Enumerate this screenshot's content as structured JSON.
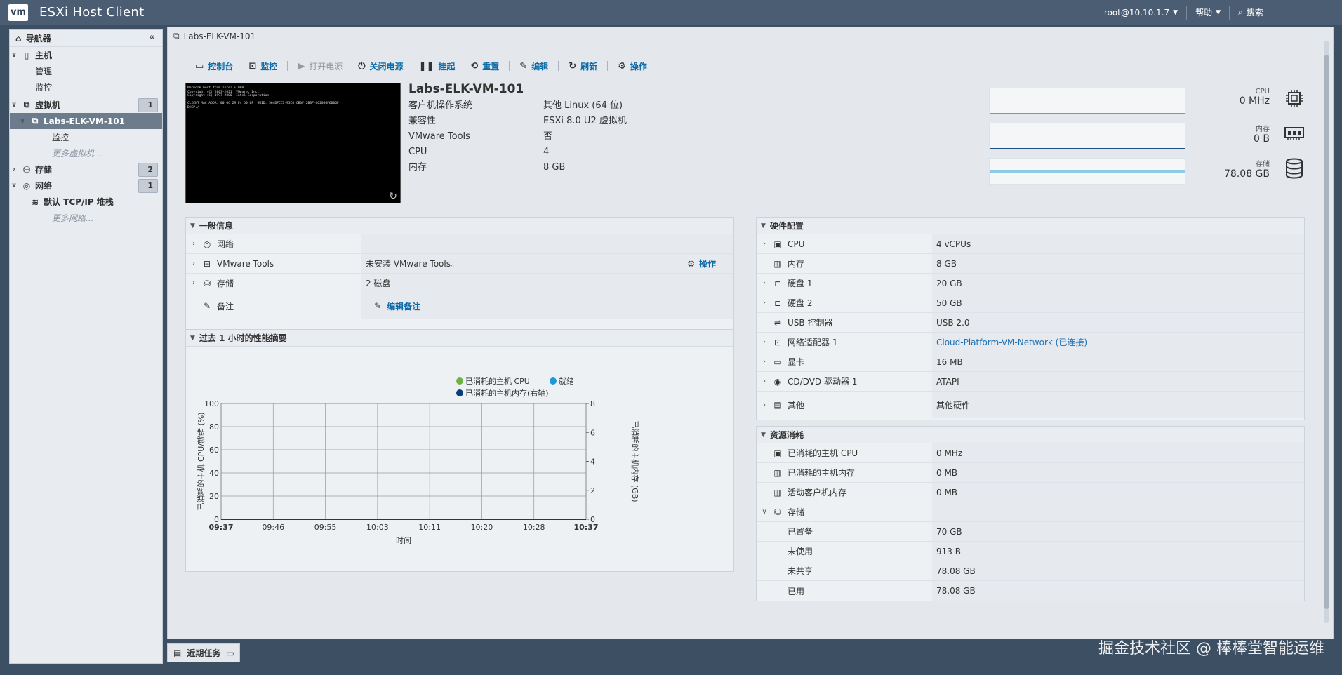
{
  "header": {
    "logo": "vm",
    "title": "ESXi Host Client",
    "user": "root@10.10.1.7",
    "help": "帮助",
    "search": "搜索"
  },
  "navigator": {
    "title": "导航器",
    "items": [
      {
        "label": "主机",
        "bold": true
      },
      {
        "label": "管理"
      },
      {
        "label": "监控"
      },
      {
        "label": "虚拟机",
        "badge": "1"
      },
      {
        "label": "Labs-ELK-VM-101"
      },
      {
        "label": "监控"
      },
      {
        "label": "更多虚拟机..."
      },
      {
        "label": "存储",
        "badge": "2"
      },
      {
        "label": "网络",
        "badge": "1"
      },
      {
        "label": "默认 TCP/IP 堆栈"
      },
      {
        "label": "更多网络..."
      }
    ]
  },
  "breadcrumb": "Labs-ELK-VM-101",
  "toolbar": {
    "console": "控制台",
    "monitor": "监控",
    "power_on": "打开电源",
    "power_off": "关闭电源",
    "suspend": "挂起",
    "reset": "重置",
    "edit": "编辑",
    "refresh": "刷新",
    "actions": "操作"
  },
  "console_text": "Network boot from Intel E1000\nCopyright (C) 2003-2021  VMware, Inc.\nCopyright (C) 1997-2000  Intel Corporation\n\nCLIENT MAC ADDR: 00 0C 29 F4 D0 6F  GUID: 564DFCC7-93C0-CBDF-2BBF-C62056F6D06F\nDHCP./",
  "vm": {
    "name": "Labs-ELK-VM-101",
    "props": [
      {
        "k": "客户机操作系统",
        "v": "其他 Linux (64 位)"
      },
      {
        "k": "兼容性",
        "v": "ESXi 8.0 U2 虚拟机"
      },
      {
        "k": "VMware Tools",
        "v": "否"
      },
      {
        "k": "CPU",
        "v": "4"
      },
      {
        "k": "内存",
        "v": "8 GB"
      }
    ]
  },
  "gauges": [
    {
      "label": "CPU",
      "value": "0 MHz",
      "color": "#6db33f"
    },
    {
      "label": "内存",
      "value": "0 B",
      "color": "#1f4f8a"
    },
    {
      "label": "存储",
      "value": "78.08 GB",
      "color": "#8ccbe0"
    }
  ],
  "general": {
    "title": "一般信息",
    "rows": [
      {
        "k": "网络",
        "v": ""
      },
      {
        "k": "VMware Tools",
        "v": "未安装 VMware Tools。",
        "action": "操作"
      },
      {
        "k": "存储",
        "v": "2 磁盘"
      },
      {
        "k": "备注",
        "action": "编辑备注"
      }
    ]
  },
  "perf": {
    "title": "过去 1 小时的性能摘要"
  },
  "chart_data": {
    "type": "line",
    "series": [
      {
        "name": "已消耗的主机 CPU",
        "color": "#6db33f",
        "values": [
          0,
          0,
          0,
          0,
          0,
          0,
          0,
          0
        ]
      },
      {
        "name": "就绪",
        "color": "#1a9ad6",
        "values": [
          0,
          0,
          0,
          0,
          0,
          0,
          0,
          0
        ]
      },
      {
        "name": "已消耗的主机内存(右轴)",
        "color": "#0b3c7a",
        "values": [
          0,
          0,
          0,
          0,
          0,
          0,
          0,
          0
        ]
      }
    ],
    "x": [
      "09:37",
      "09:46",
      "09:55",
      "10:03",
      "10:11",
      "10:20",
      "10:28",
      "10:37"
    ],
    "xlabel": "时间",
    "ylabel": "已消耗的主机 CPU/就绪 (%)",
    "y2label": "已消耗的主机内存 (GB)",
    "ylim": [
      0,
      100
    ],
    "y2lim": [
      0,
      8
    ],
    "yticks": [
      0,
      20,
      40,
      60,
      80,
      100
    ],
    "y2ticks": [
      0,
      2,
      4,
      6,
      8
    ],
    "grid": true,
    "legend": "top-right"
  },
  "hardware": {
    "title": "硬件配置",
    "rows": [
      {
        "k": "CPU",
        "v": "4 vCPUs",
        "exp": true
      },
      {
        "k": "内存",
        "v": "8 GB"
      },
      {
        "k": "硬盘 1",
        "v": "20 GB",
        "exp": true
      },
      {
        "k": "硬盘 2",
        "v": "50 GB",
        "exp": true
      },
      {
        "k": "USB 控制器",
        "v": "USB 2.0"
      },
      {
        "k": "网络适配器 1",
        "v": "Cloud-Platform-VM-Network (已连接)",
        "exp": true,
        "link": true
      },
      {
        "k": "显卡",
        "v": "16 MB",
        "exp": true
      },
      {
        "k": "CD/DVD 驱动器 1",
        "v": "ATAPI",
        "exp": true
      },
      {
        "k": "其他",
        "v": "其他硬件",
        "exp": true
      }
    ]
  },
  "resources": {
    "title": "资源消耗",
    "rows": [
      {
        "k": "已消耗的主机 CPU",
        "v": "0 MHz"
      },
      {
        "k": "已消耗的主机内存",
        "v": "0 MB"
      },
      {
        "k": "活动客户机内存",
        "v": "0 MB"
      },
      {
        "k": "存储",
        "v": ""
      },
      {
        "k": "已置备",
        "v": "70 GB"
      },
      {
        "k": "未使用",
        "v": "913 B"
      },
      {
        "k": "未共享",
        "v": "78.08 GB"
      },
      {
        "k": "已用",
        "v": "78.08 GB"
      }
    ]
  },
  "tasks": "近期任务",
  "watermark": "掘金技术社区 @ 棒棒堂智能运维"
}
